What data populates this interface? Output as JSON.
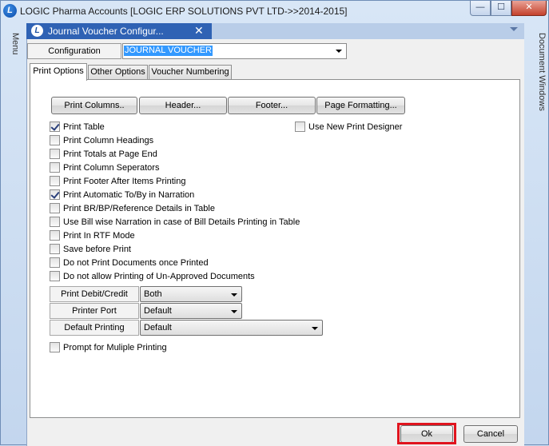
{
  "window": {
    "title": "LOGIC Pharma Accounts  [LOGIC ERP SOLUTIONS PVT LTD->>2014-2015]",
    "app_icon_letter": "L",
    "minimize": "—",
    "maximize": "☐",
    "close": "✕"
  },
  "side": {
    "menu": "Menu",
    "documents": "Document Windows"
  },
  "doc_tab": {
    "icon_letter": "L",
    "label": "Journal Voucher Configur...",
    "close": "✕"
  },
  "config": {
    "label": "Configuration",
    "value": "JOURNAL VOUCHER"
  },
  "tabs": [
    "Print Options",
    "Other Options",
    "Voucher Numbering"
  ],
  "buttons": {
    "print_columns": "Print Columns..",
    "header": "Header...",
    "footer": "Footer...",
    "page_formatting": "Page Formatting..."
  },
  "checkboxes": [
    {
      "label": "Print Table",
      "checked": true
    },
    {
      "label": "Print Column Headings",
      "checked": false
    },
    {
      "label": "Print Totals at Page End",
      "checked": false
    },
    {
      "label": "Print Column Seperators",
      "checked": false
    },
    {
      "label": "Print Footer After Items Printing",
      "checked": false
    },
    {
      "label": "Print Automatic To/By in Narration",
      "checked": true
    },
    {
      "label": "Print BR/BP/Reference Details in Table",
      "checked": false
    },
    {
      "label": "Use Bill wise Narration in case of Bill Details Printing in Table",
      "checked": false
    },
    {
      "label": "Print In RTF Mode",
      "checked": false
    },
    {
      "label": "Save before Print",
      "checked": false
    },
    {
      "label": "Do not Print Documents once Printed",
      "checked": false
    },
    {
      "label": "Do not allow Printing of Un-Approved Documents",
      "checked": false
    }
  ],
  "new_print_designer": {
    "label": "Use New Print Designer",
    "checked": false
  },
  "fields": {
    "debit_credit": {
      "label": "Print Debit/Credit",
      "value": "Both"
    },
    "printer_port": {
      "label": "Printer Port",
      "value": "Default"
    },
    "default_printing": {
      "label": "Default Printing",
      "value": "Default"
    }
  },
  "prompt_multiple": {
    "label": "Prompt for Muliple Printing",
    "checked": false
  },
  "footer_buttons": {
    "ok": "Ok",
    "cancel": "Cancel"
  }
}
